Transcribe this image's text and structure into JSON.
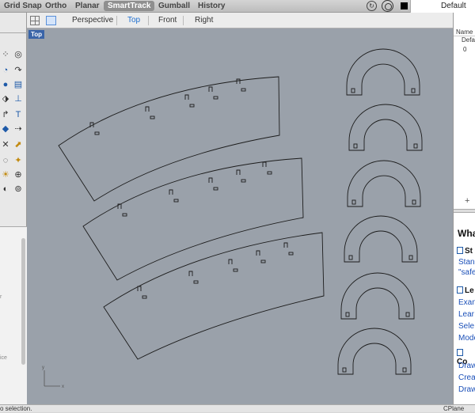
{
  "modes": [
    {
      "label": "Grid Snap",
      "active": false
    },
    {
      "label": "Ortho",
      "active": false
    },
    {
      "label": "Planar",
      "active": false
    },
    {
      "label": "SmartTrack",
      "active": true
    },
    {
      "label": "Gumball",
      "active": false
    },
    {
      "label": "History",
      "active": false
    }
  ],
  "layer": {
    "current": "Default",
    "swatch_color": "#000000"
  },
  "viewport": {
    "tabs": [
      "Perspective",
      "Top",
      "Front",
      "Right"
    ],
    "selected_tab": "Top",
    "label": "Top",
    "axis_labels": {
      "x": "x",
      "y": "y"
    }
  },
  "layers_panel": {
    "header": "Name",
    "rows": [
      "Defa",
      "0"
    ],
    "add_symbol": "+"
  },
  "help_panel": {
    "title": "Wha",
    "sections": [
      {
        "icon": "book-icon",
        "title": "St",
        "links": [
          "Stan",
          "\"safe"
        ]
      },
      {
        "icon": "book-icon",
        "title": "Le",
        "links": [
          "Exan",
          "Lear",
          "Sele",
          "Mode"
        ]
      },
      {
        "icon": "book-icon",
        "title": "Co",
        "links": [
          "Draw",
          "Crea",
          "Draw"
        ]
      }
    ]
  },
  "left_stubs": [
    "r",
    "ice"
  ],
  "status": {
    "text": "o selection.",
    "cplane": "CPlane"
  },
  "colors": {
    "viewport_bg": "#9aa1aa",
    "selected_tab": "#1f6fd0",
    "active_mode": "#8f8f8f",
    "link": "#1a4fb8"
  }
}
